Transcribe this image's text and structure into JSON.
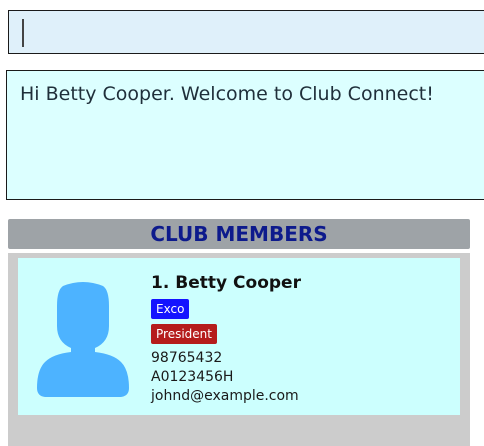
{
  "command_box": {
    "value": ""
  },
  "result_display": {
    "text": "Hi Betty Cooper. Welcome to Club Connect!"
  },
  "members_panel": {
    "title": "CLUB MEMBERS",
    "members": [
      {
        "index": "1.",
        "name": "Betty Cooper",
        "tags": [
          "Exco",
          "President"
        ],
        "phone": "98765432",
        "matric": "A0123456H",
        "email": "johnd@example.com"
      }
    ]
  },
  "colors": {
    "command_bg": "#dff0fa",
    "result_bg": "#dcffff",
    "header_bg": "#9ea3a7",
    "header_text": "#0d1a8c",
    "card_bg": "#ccfffe",
    "tag_exco": "#1414ff",
    "tag_president": "#b51c1c",
    "avatar": "#4db3ff"
  },
  "icons": {
    "avatar": "user-silhouette-icon"
  }
}
